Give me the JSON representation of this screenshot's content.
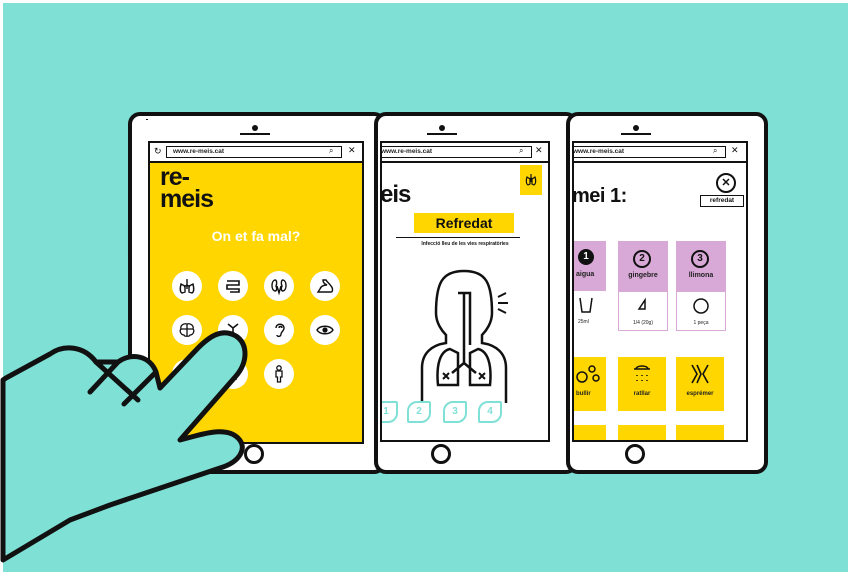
{
  "tablet1": {
    "url": "www.re-meis.cat",
    "logo_line1": "re-",
    "logo_line2": "meis",
    "question": "On et fa mal?",
    "icons": [
      "lungs-icon",
      "intestine-icon",
      "kidneys-icon",
      "arm-muscle-icon",
      "brain-icon",
      "joint-icon",
      "ear-icon",
      "eye-icon",
      "stomach-icon",
      "throat-icon",
      "body-icon"
    ]
  },
  "tablet2": {
    "url": "www.re-meis.cat",
    "logo_part": "eis",
    "title": "Refredat",
    "subtitle": "Infecció lleu de les vies respiratòries",
    "steps": [
      "1",
      "2",
      "3",
      "4"
    ]
  },
  "tablet3": {
    "url": "www.re-meis.cat",
    "heading": "mei 1:",
    "tag": "refredat",
    "ingredients": [
      {
        "number": "1",
        "name": "aigua",
        "amount": "25ml"
      },
      {
        "number": "2",
        "name": "gingebre",
        "amount": "1/4 (20g)"
      },
      {
        "number": "3",
        "name": "llimona",
        "amount": "1 peça"
      }
    ],
    "actions": [
      "bullir",
      "ratllar",
      "esprémer"
    ]
  },
  "colors": {
    "background": "#7fe0d6",
    "yellow": "#ffd600",
    "lilac": "#d8a8d6",
    "ink": "#111111"
  }
}
